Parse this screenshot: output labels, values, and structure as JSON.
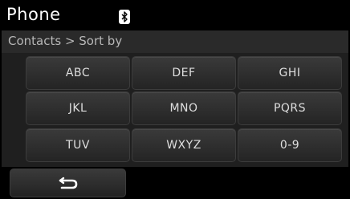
{
  "header": {
    "title": "Phone",
    "bluetooth_icon": "bluetooth-icon"
  },
  "breadcrumb": {
    "text": "Contacts > Sort by"
  },
  "keys": [
    [
      "ABC",
      "DEF",
      "GHI"
    ],
    [
      "JKL",
      "MNO",
      "PQRS"
    ],
    [
      "TUV",
      "WXYZ",
      "0-9"
    ]
  ],
  "footer": {
    "back_icon": "back-arrow-icon"
  },
  "colors": {
    "background": "#000000",
    "panel": "#1f1f1f",
    "breadcrumb_bar": "#2a2a2a",
    "key_text": "#dedede"
  }
}
